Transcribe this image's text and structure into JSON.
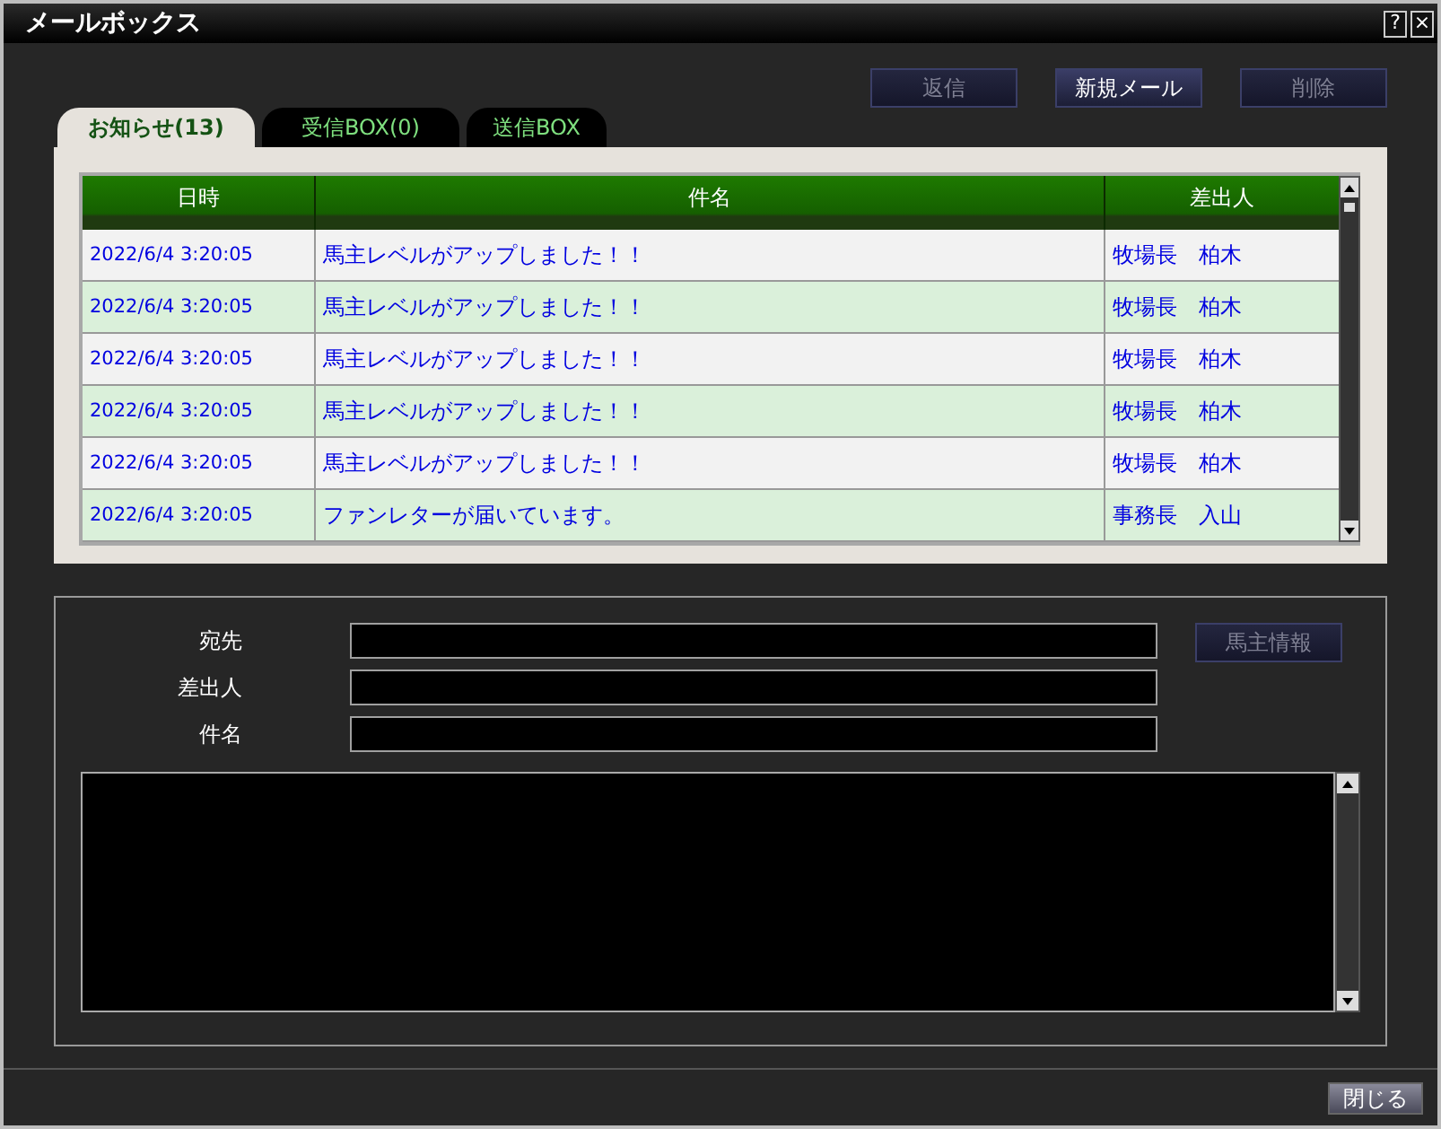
{
  "window": {
    "title": "メールボックス",
    "help_button": "?",
    "close_button": "×"
  },
  "actions": [
    {
      "label": "返信",
      "disabled": true
    },
    {
      "label": "新規メール",
      "disabled": false
    },
    {
      "label": "削除",
      "disabled": true
    }
  ],
  "tabs": [
    {
      "label": "お知らせ(13)",
      "selected": true
    },
    {
      "label": "受信BOX(0)",
      "selected": false
    },
    {
      "label": "送信BOX",
      "selected": false
    }
  ],
  "table": {
    "columns": [
      "日時",
      "件名",
      "差出人"
    ],
    "rows": [
      [
        "2022/6/4 3:20:05",
        "馬主レベルがアップしました！！",
        "牧場長　柏木"
      ],
      [
        "2022/6/4 3:20:05",
        "馬主レベルがアップしました！！",
        "牧場長　柏木"
      ],
      [
        "2022/6/4 3:20:05",
        "馬主レベルがアップしました！！",
        "牧場長　柏木"
      ],
      [
        "2022/6/4 3:20:05",
        "馬主レベルがアップしました！！",
        "牧場長　柏木"
      ],
      [
        "2022/6/4 3:20:05",
        "馬主レベルがアップしました！！",
        "牧場長　柏木"
      ],
      [
        "2022/6/4 3:20:05",
        "ファンレターが届いています。",
        "事務長　入山"
      ]
    ]
  },
  "detail": {
    "fields": [
      {
        "label": "宛先"
      },
      {
        "label": "差出人"
      },
      {
        "label": "件名"
      }
    ],
    "owner_button": {
      "label": "馬主情報",
      "disabled": true
    }
  },
  "footer": {
    "close_button": "閉じる"
  }
}
